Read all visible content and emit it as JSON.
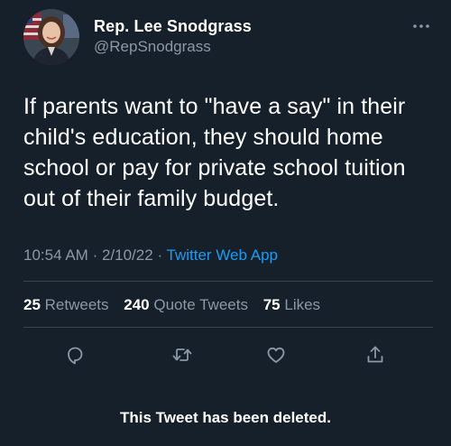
{
  "author": {
    "display_name": "Rep. Lee Snodgrass",
    "handle": "@RepSnodgrass",
    "avatar_icon": "profile-photo"
  },
  "more_icon": "more-horizontal-icon",
  "tweet": {
    "text": "If parents want to \"have a say\" in their child's education, they should home school or pay for private school tuition out of their family budget.",
    "time": "10:54 AM",
    "separator": "·",
    "date": "2/10/22",
    "source": "Twitter Web App"
  },
  "stats": {
    "retweets_count": "25",
    "retweets_label": "Retweets",
    "quotes_count": "240",
    "quotes_label": "Quote Tweets",
    "likes_count": "75",
    "likes_label": "Likes"
  },
  "actions": {
    "reply_icon": "reply-icon",
    "retweet_icon": "retweet-icon",
    "like_icon": "heart-icon",
    "share_icon": "share-icon"
  },
  "notice": "This Tweet has been deleted.",
  "colors": {
    "background": "#15202b",
    "text_primary": "#ffffff",
    "text_secondary": "#8b98a5",
    "link": "#1d9bf0",
    "divider": "#38444d"
  }
}
